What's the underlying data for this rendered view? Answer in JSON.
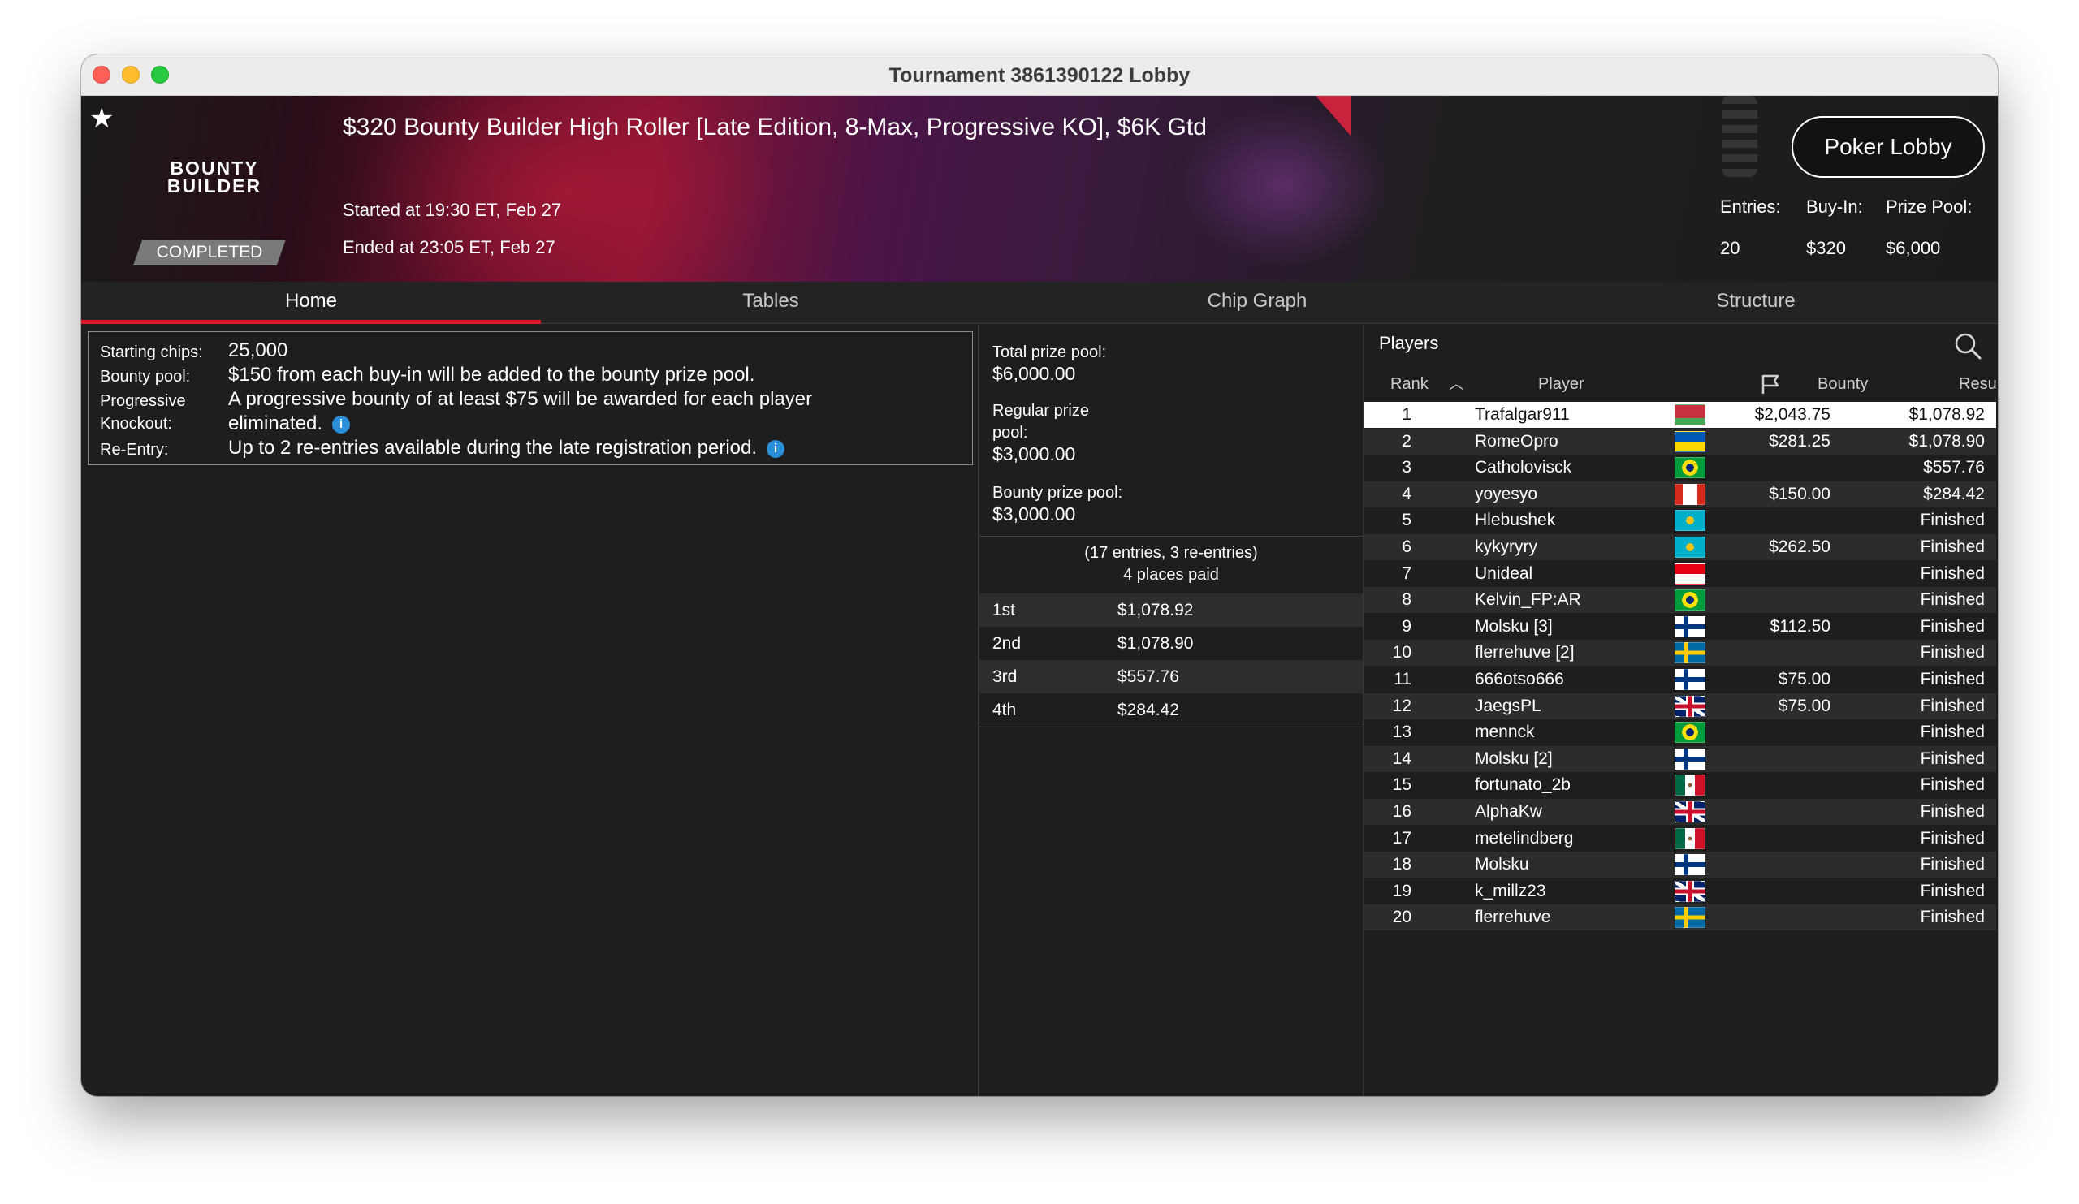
{
  "window": {
    "title": "Tournament 3861390122 Lobby"
  },
  "banner": {
    "logo_line1": "BOUNTY",
    "logo_line2": "BUILDER",
    "status": "COMPLETED",
    "tournament_name": "$320 Bounty Builder High Roller [Late Edition, 8-Max, Progressive KO], $6K Gtd",
    "started": "Started at 19:30 ET, Feb 27",
    "ended": "Ended at 23:05 ET, Feb 27",
    "poker_lobby_label": "Poker Lobby",
    "entries_label": "Entries:",
    "entries_value": "20",
    "buyin_label": "Buy-In:",
    "buyin_value": "$320",
    "prizepool_label": "Prize Pool:",
    "prizepool_value": "$6,000",
    "icons": {
      "favorite": "star-icon"
    }
  },
  "tabs": [
    {
      "label": "Home",
      "active": true
    },
    {
      "label": "Tables",
      "active": false
    },
    {
      "label": "Chip Graph",
      "active": false
    },
    {
      "label": "Structure",
      "active": false
    }
  ],
  "home": {
    "starting_chips_label": "Starting chips:",
    "starting_chips_value": "25,000",
    "bounty_pool_label": "Bounty pool:",
    "bounty_pool_value": "$150 from each buy-in will be added to the bounty prize pool.",
    "progressive_label_1": "Progressive",
    "progressive_label_2": "Knockout:",
    "progressive_value_1": "A progressive bounty of at least $75 will be awarded for each player",
    "progressive_value_2": "eliminated.",
    "reentry_label": "Re-Entry:",
    "reentry_value": "Up to 2 re-entries available during the late registration period.",
    "info_glyph": "i"
  },
  "prizes": {
    "total_label": "Total prize pool:",
    "total_value": "$6,000.00",
    "regular_label_1": "Regular prize",
    "regular_label_2": "pool:",
    "regular_value": "$3,000.00",
    "bounty_label": "Bounty prize pool:",
    "bounty_value": "$3,000.00",
    "entries_note_1": "(17 entries, 3 re-entries)",
    "entries_note_2": "4 places paid",
    "places": [
      {
        "place": "1st",
        "amount": "$1,078.92"
      },
      {
        "place": "2nd",
        "amount": "$1,078.90"
      },
      {
        "place": "3rd",
        "amount": "$557.76"
      },
      {
        "place": "4th",
        "amount": "$284.42"
      }
    ]
  },
  "players": {
    "title": "Players",
    "columns": {
      "rank": "Rank",
      "player": "Player",
      "bounty": "Bounty",
      "results": "Results"
    },
    "rows": [
      {
        "rank": "1",
        "name": "Trafalgar911",
        "country": "Belarus",
        "bounty": "$2,043.75",
        "result": "$1,078.92"
      },
      {
        "rank": "2",
        "name": "RomeOpro",
        "country": "Ukraine",
        "bounty": "$281.25",
        "result": "$1,078.90"
      },
      {
        "rank": "3",
        "name": "Catholovisck",
        "country": "Brazil",
        "bounty": "",
        "result": "$557.76"
      },
      {
        "rank": "4",
        "name": "yoyesyo",
        "country": "Canada",
        "bounty": "$150.00",
        "result": "$284.42"
      },
      {
        "rank": "5",
        "name": "Hlebushek",
        "country": "Kazakhstan",
        "bounty": "",
        "result": "Finished"
      },
      {
        "rank": "6",
        "name": "kykyryry",
        "country": "Kazakhstan",
        "bounty": "$262.50",
        "result": "Finished"
      },
      {
        "rank": "7",
        "name": "Unideal",
        "country": "Indonesia",
        "bounty": "",
        "result": "Finished"
      },
      {
        "rank": "8",
        "name": "Kelvin_FP:AR",
        "country": "Brazil",
        "bounty": "",
        "result": "Finished"
      },
      {
        "rank": "9",
        "name": "Molsku [3]",
        "country": "Finland",
        "bounty": "$112.50",
        "result": "Finished"
      },
      {
        "rank": "10",
        "name": "flerrehuve [2]",
        "country": "Sweden",
        "bounty": "",
        "result": "Finished"
      },
      {
        "rank": "11",
        "name": "666otso666",
        "country": "Finland",
        "bounty": "$75.00",
        "result": "Finished"
      },
      {
        "rank": "12",
        "name": "JaegsPL",
        "country": "UK",
        "bounty": "$75.00",
        "result": "Finished"
      },
      {
        "rank": "13",
        "name": "mennck",
        "country": "Brazil",
        "bounty": "",
        "result": "Finished"
      },
      {
        "rank": "14",
        "name": "Molsku [2]",
        "country": "Finland",
        "bounty": "",
        "result": "Finished"
      },
      {
        "rank": "15",
        "name": "fortunato_2b",
        "country": "Mexico",
        "bounty": "",
        "result": "Finished"
      },
      {
        "rank": "16",
        "name": "AlphaKw",
        "country": "UK",
        "bounty": "",
        "result": "Finished"
      },
      {
        "rank": "17",
        "name": "metelindberg",
        "country": "Mexico",
        "bounty": "",
        "result": "Finished"
      },
      {
        "rank": "18",
        "name": "Molsku",
        "country": "Finland",
        "bounty": "",
        "result": "Finished"
      },
      {
        "rank": "19",
        "name": "k_millz23",
        "country": "UK",
        "bounty": "",
        "result": "Finished"
      },
      {
        "rank": "20",
        "name": "flerrehuve",
        "country": "Sweden",
        "bounty": "",
        "result": "Finished"
      }
    ]
  }
}
